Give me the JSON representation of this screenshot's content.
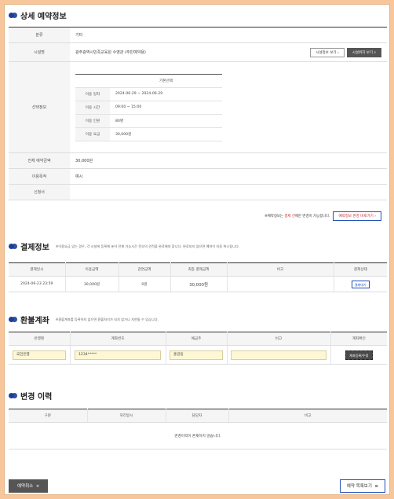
{
  "detail": {
    "title": "상세 예약정보",
    "rows": {
      "category_label": "분류",
      "category_value": "기타",
      "facility_label": "시설명",
      "facility_value": "광주광역시민족교육원 수영관 (주민예약용)",
      "facility_info_btn": "시설정보 보기",
      "facility_loc_btn": "시설위치 보기",
      "select_label": "선택정보",
      "total_label": "전체 예약금액",
      "total_value": "30,000원",
      "purpose_label": "이용목적",
      "purpose_value": "예시",
      "applicant_label": "신청서",
      "applicant_value": ""
    },
    "select_info": {
      "header": "기본선택",
      "rows": [
        {
          "label": "이용 일자",
          "value": "2024-06-29 ~ 2024-06-29"
        },
        {
          "label": "이용 시간",
          "value": "09:00 ~ 15:00"
        },
        {
          "label": "이용 인원",
          "value": "80명"
        },
        {
          "label": "이용 요금",
          "value": "30,000원"
        }
      ]
    },
    "notice_pre": "※예약정보는 ",
    "notice_red": "결제 전",
    "notice_post": "에만 변경이 가능합니다.",
    "change_btn": "예약정보 변경 바로가기"
  },
  "payment": {
    "title": "결제정보",
    "note": "※이용요금 있는 경우, 각 시설에 등록해 놓아 전체 가능시간 전부의 견적을 완료해야 합니다. 완료되지 않으면 예약이 자동 취소됩니다.",
    "headers": [
      "결제일시",
      "이용금액",
      "감면금액",
      "최종 결제금액",
      "비고",
      "결제상태"
    ],
    "row": {
      "date": "2024-06-23 23:59",
      "amount": "30,000원",
      "discount": "0원",
      "final": "30,000원",
      "memo": "",
      "status": "결제대기"
    }
  },
  "refund": {
    "title": "환불계좌",
    "note": "※환불계좌를 등록하지 않으면 환불처리가 되지 않거나 지연될 수 있습니다.",
    "headers": [
      "은행명",
      "계좌번호",
      "예금주",
      "비고",
      "계좌확인"
    ],
    "row": {
      "bank": "국민은행",
      "account": "1234*****",
      "holder": "홍길동",
      "memo": "",
      "btn": "계좌등록/수정"
    }
  },
  "history": {
    "title": "변경 이력",
    "headers": [
      "구분",
      "처리일시",
      "담당자",
      "비고"
    ],
    "empty": "변경이력이 존재하지 않습니다."
  },
  "footer": {
    "cancel_btn": "예약취소",
    "list_btn": "예약 목록보기"
  }
}
